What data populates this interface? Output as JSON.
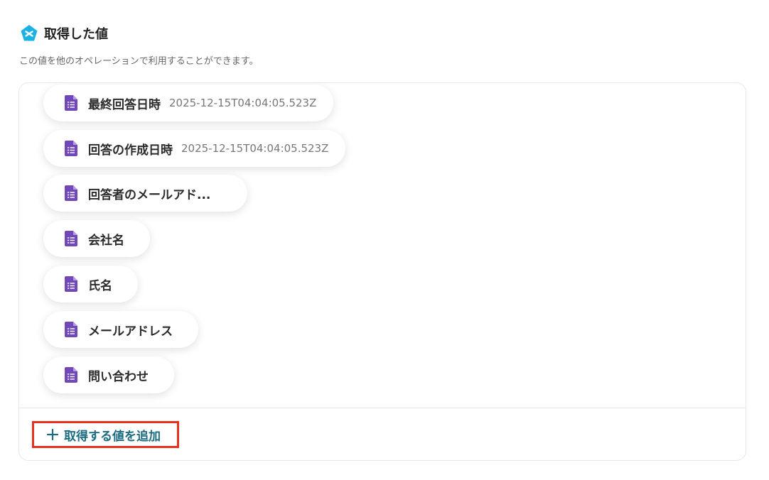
{
  "header": {
    "title": "取得した値",
    "subtitle": "この値を他のオペレーションで利用することができます。",
    "icon": "yoom-logo-icon",
    "icon_color": "#1ab2e6"
  },
  "items": [
    {
      "label": "最終回答日時",
      "value": "2025-12-15T04:04:05.523Z"
    },
    {
      "label": "回答の作成日時",
      "value": "2025-12-15T04:04:05.523Z"
    },
    {
      "label": "回答者のメールアド...",
      "value": ""
    },
    {
      "label": "会社名",
      "value": ""
    },
    {
      "label": "氏名",
      "value": ""
    },
    {
      "label": "メールアドレス",
      "value": ""
    },
    {
      "label": "問い合わせ",
      "value": ""
    }
  ],
  "item_icon": "google-forms-icon",
  "item_icon_color": "#7248b9",
  "add_button": {
    "label": "取得する値を追加",
    "icon": "plus-icon",
    "color": "#1b6c80",
    "highlight_color": "#e8321e"
  }
}
